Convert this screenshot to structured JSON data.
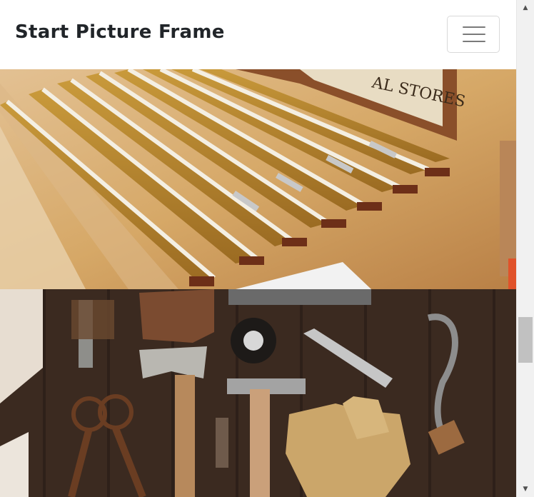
{
  "navbar": {
    "brand": "Start Picture Frame",
    "toggler_icon": "hamburger-menu-icon"
  },
  "gallery": {
    "items": [
      {
        "name": "rulers-photo",
        "subject": "folding rulers on wooden bench"
      },
      {
        "name": "tools-photo",
        "subject": "vintage hand tools on dark wood"
      }
    ]
  },
  "scrollbar": {
    "up_icon": "▲",
    "down_icon": "▼",
    "position": 0.66
  },
  "colors": {
    "brand_text": "#212529",
    "toggler_border": "#d9d9d9",
    "scrollbar_track": "#f1f1f1",
    "scrollbar_thumb": "#c1c1c1"
  }
}
